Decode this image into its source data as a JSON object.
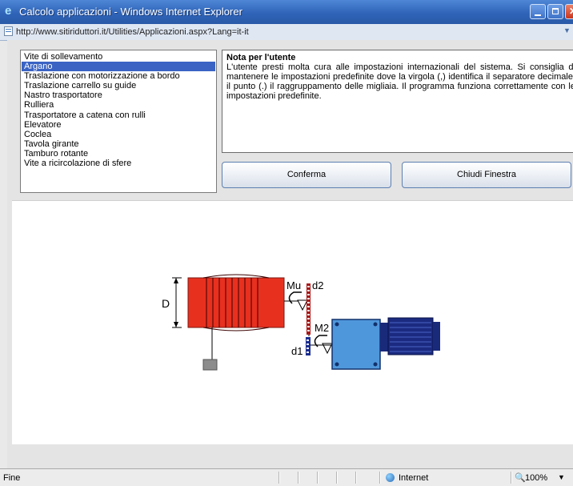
{
  "window": {
    "title": "Calcolo applicazioni - Windows Internet Explorer",
    "url": "http://www.sitiriduttori.it/Utilities/Applicazioni.aspx?Lang=it-it"
  },
  "applications": {
    "items": [
      {
        "label": "Vite di sollevamento",
        "selected": false
      },
      {
        "label": "Argano",
        "selected": true
      },
      {
        "label": "Traslazione con motorizzazione a bordo",
        "selected": false
      },
      {
        "label": "Traslazione carrello su guide",
        "selected": false
      },
      {
        "label": "Nastro trasportatore",
        "selected": false
      },
      {
        "label": "Rulliera",
        "selected": false
      },
      {
        "label": "Trasportatore a catena con rulli",
        "selected": false
      },
      {
        "label": "Elevatore",
        "selected": false
      },
      {
        "label": "Coclea",
        "selected": false
      },
      {
        "label": "Tavola girante",
        "selected": false
      },
      {
        "label": "Tamburo rotante",
        "selected": false
      },
      {
        "label": "Vite a ricircolazione di sfere",
        "selected": false
      }
    ]
  },
  "note": {
    "title": "Nota per l'utente",
    "body": "L'utente presti molta cura alle impostazioni internazionali del sistema. Si consiglia di mantenere le impostazioni predefinite dove la virgola (,) identifica il separatore decimale, il punto (.) il raggruppamento delle migliaia. Il programma funziona correttamente con le impostazioni predefinite."
  },
  "buttons": {
    "confirm": "Conferma",
    "close_window": "Chiudi Finestra"
  },
  "diagram": {
    "labels": {
      "diameter": "D",
      "torque_u": "Mu",
      "gear_d2": "d2",
      "torque_2": "M2",
      "gear_d1": "d1"
    },
    "colors": {
      "drum": "#e8301f",
      "gearbox": "#4f97db",
      "motor": "#1b2a80",
      "chain": "#a81a1a",
      "load": "#8c8c8c"
    }
  },
  "status": {
    "left": "Fine",
    "zone": "Internet",
    "zoom": "100%"
  }
}
